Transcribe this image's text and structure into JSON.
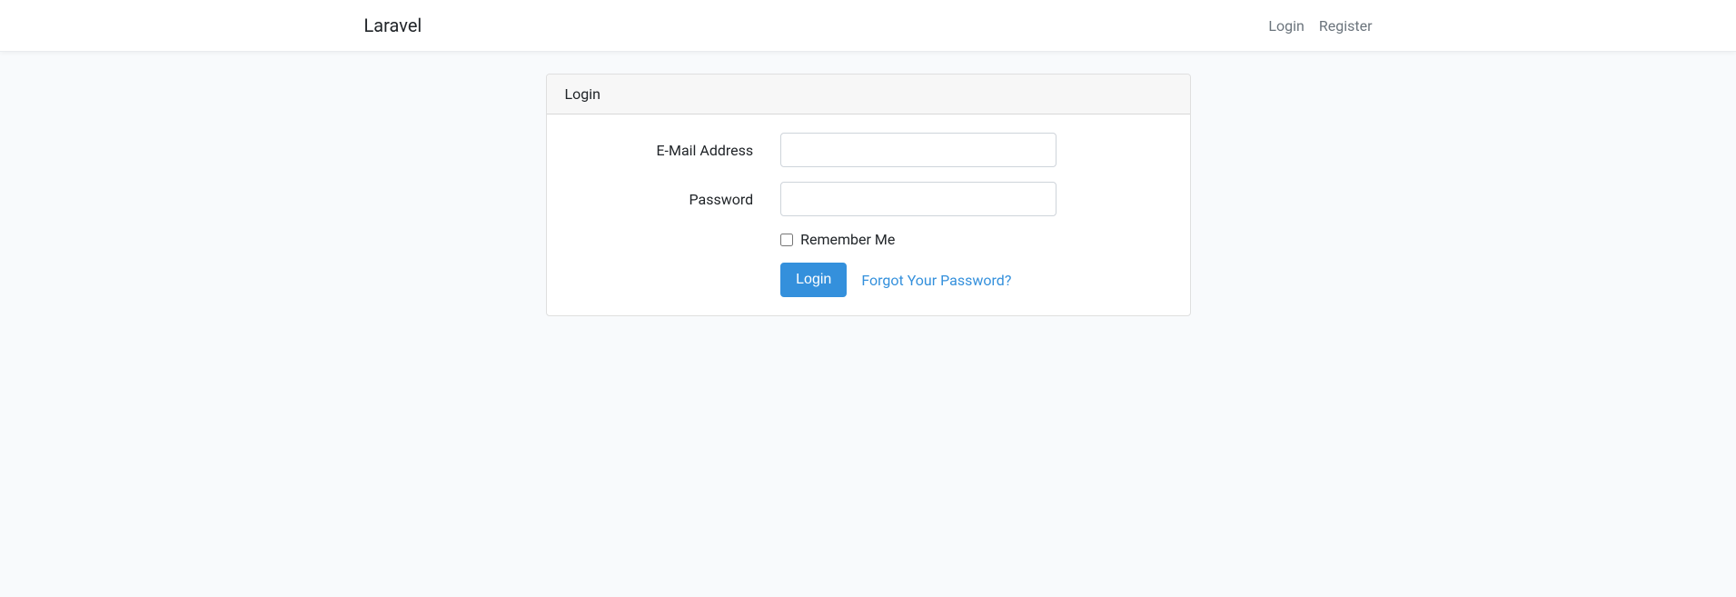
{
  "navbar": {
    "brand": "Laravel",
    "login_link": "Login",
    "register_link": "Register"
  },
  "card": {
    "header": "Login"
  },
  "form": {
    "email_label": "E-Mail Address",
    "email_value": "",
    "password_label": "Password",
    "password_value": "",
    "remember_label": "Remember Me",
    "submit_label": "Login",
    "forgot_password_label": "Forgot Your Password?"
  }
}
